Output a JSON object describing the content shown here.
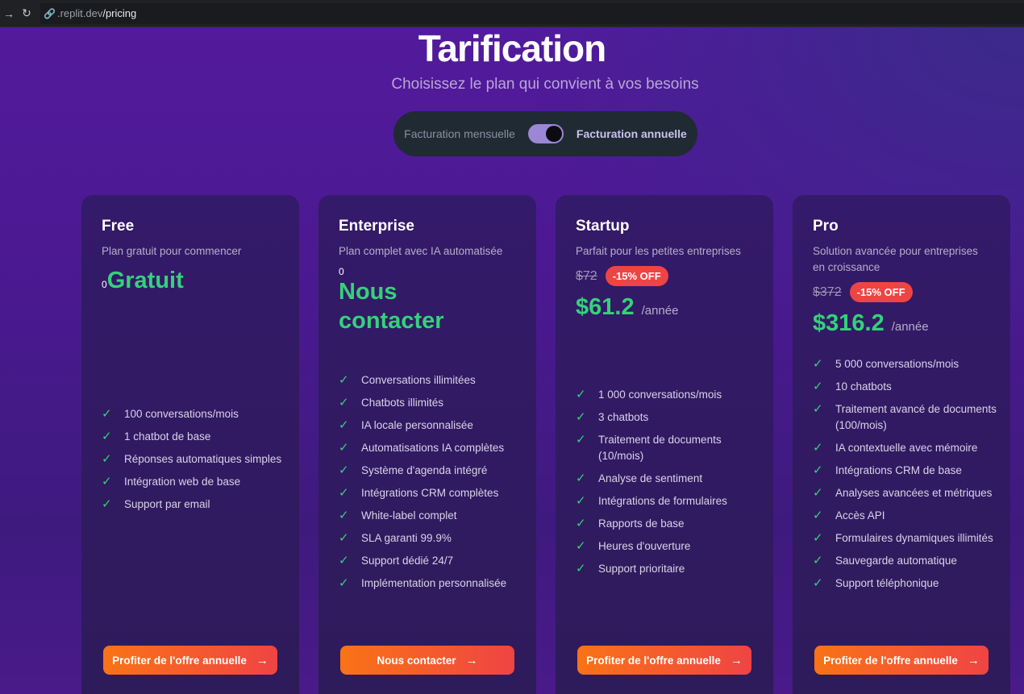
{
  "browser": {
    "back_icon": "arrow-right-icon",
    "reload_icon": "reload-icon",
    "url_host": ".replit.dev",
    "url_path": "/pricing"
  },
  "header": {
    "title": "Tarification",
    "subtitle": "Choisissez le plan qui convient à vos besoins"
  },
  "billing_toggle": {
    "monthly_label": "Facturation mensuelle",
    "annual_label": "Facturation annuelle",
    "selected": "annual"
  },
  "plans": [
    {
      "name": "Free",
      "description": "Plan gratuit pour commencer",
      "zero": "0",
      "price_text": "Gratuit",
      "features": [
        "100 conversations/mois",
        "1 chatbot de base",
        "Réponses automatiques simples",
        "Intégration web de base",
        "Support par email"
      ],
      "cta": "Profiter de l'offre annuelle"
    },
    {
      "name": "Enterprise",
      "description": "Plan complet avec IA automatisée",
      "zero": "0",
      "price_text": "Nous contacter",
      "features": [
        "Conversations illimitées",
        "Chatbots illimités",
        "IA locale personnalisée",
        "Automatisations IA complètes",
        "Système d'agenda intégré",
        "Intégrations CRM complètes",
        "White-label complet",
        "SLA garanti 99.9%",
        "Support dédié 24/7",
        "Implémentation personnalisée"
      ],
      "cta": "Nous contacter"
    },
    {
      "name": "Startup",
      "description": "Parfait pour les petites entreprises",
      "old_price": "$72",
      "discount": "-15% OFF",
      "price": "$61.2",
      "period": "/année",
      "features": [
        "1 000 conversations/mois",
        "3 chatbots",
        "Traitement de documents (10/mois)",
        "Analyse de sentiment",
        "Intégrations de formulaires",
        "Rapports de base",
        "Heures d'ouverture",
        "Support prioritaire"
      ],
      "cta": "Profiter de l'offre annuelle"
    },
    {
      "name": "Pro",
      "description": "Solution avancée pour entreprises en croissance",
      "old_price": "$372",
      "discount": "-15% OFF",
      "price": "$316.2",
      "period": "/année",
      "features": [
        "5 000 conversations/mois",
        "10 chatbots",
        "Traitement avancé de documents (100/mois)",
        "IA contextuelle avec mémoire",
        "Intégrations CRM de base",
        "Analyses avancées et métriques",
        "Accès API",
        "Formulaires dynamiques illimités",
        "Sauvegarde automatique",
        "Support téléphonique"
      ],
      "cta": "Profiter de l'offre annuelle"
    }
  ],
  "icons": {
    "check": "check-icon",
    "arrow": "arrow-right-icon"
  },
  "colors": {
    "background": "#4a1a8f",
    "card": "#341a6a",
    "price_green": "#34d27a",
    "cta_start": "#f97316",
    "cta_end": "#ef4444",
    "discount_badge": "#ef4444"
  }
}
